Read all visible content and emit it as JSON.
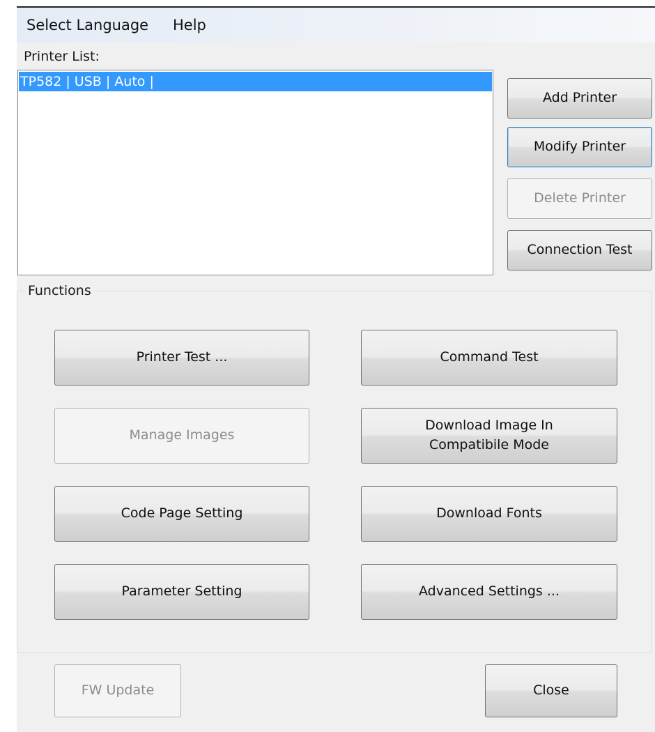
{
  "menu": {
    "items": [
      "Select Language",
      "Help"
    ]
  },
  "printer_list": {
    "label": "Printer List:",
    "items": [
      "TP582 | USB | Auto | "
    ]
  },
  "side_buttons": {
    "add": "Add Printer",
    "modify": "Modify Printer",
    "delete": "Delete Printer",
    "connection_test": "Connection Test"
  },
  "functions": {
    "title": "Functions",
    "printer_test": "Printer Test ...",
    "command_test": "Command Test",
    "manage_images": "Manage Images",
    "download_image_line1": "Download Image In",
    "download_image_line2": "Compatibile Mode",
    "code_page_setting": "Code Page Setting",
    "download_fonts": "Download Fonts",
    "parameter_setting": "Parameter Setting",
    "advanced_settings": "Advanced Settings ..."
  },
  "footer": {
    "fw_update": "FW Update",
    "close": "Close"
  },
  "colors": {
    "selection": "#3399ff",
    "focus_border": "#3c7fb1"
  }
}
